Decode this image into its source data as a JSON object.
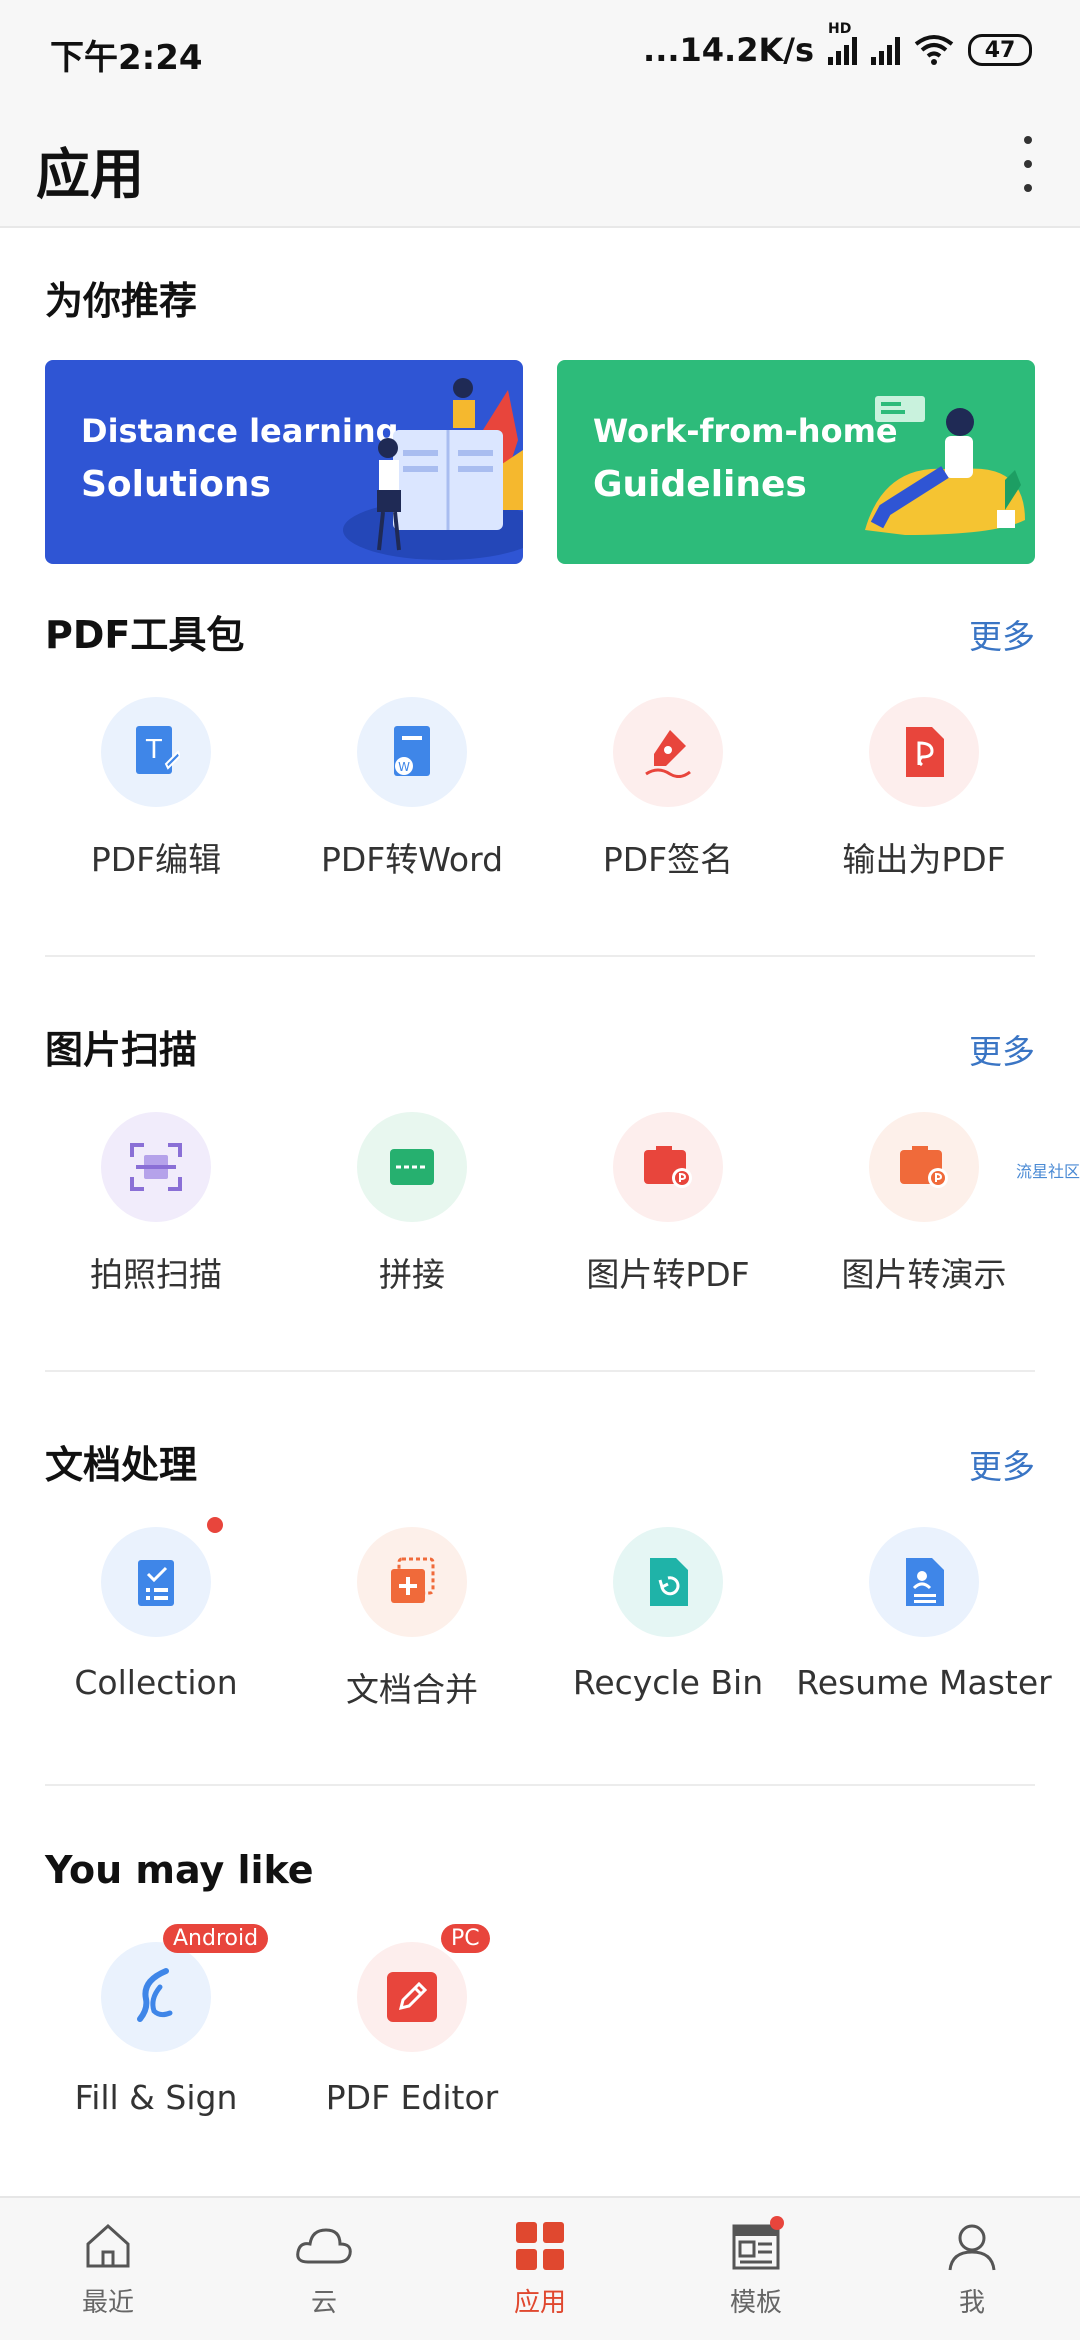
{
  "status_bar": {
    "time": "下午2:24",
    "network_speed": "...14.2K/s",
    "network_badge": "HD",
    "battery": "47"
  },
  "header": {
    "title": "应用"
  },
  "recommend": {
    "title": "为你推荐",
    "banners": [
      {
        "line1": "Distance learning",
        "line2": "Solutions",
        "color": "#2f55d4"
      },
      {
        "line1": "Work-from-home",
        "line2": "Guidelines",
        "color": "#2dbb7a"
      }
    ]
  },
  "pdf_tools": {
    "title": "PDF工具包",
    "more": "更多",
    "items": [
      {
        "label": "PDF编辑",
        "icon": "pdf-edit-icon"
      },
      {
        "label": "PDF转Word",
        "icon": "pdf-to-word-icon"
      },
      {
        "label": "PDF签名",
        "icon": "pdf-sign-icon"
      },
      {
        "label": "输出为PDF",
        "icon": "export-pdf-icon"
      }
    ]
  },
  "image_scan": {
    "title": "图片扫描",
    "more": "更多",
    "items": [
      {
        "label": "拍照扫描",
        "icon": "photo-scan-icon"
      },
      {
        "label": "拼接",
        "icon": "stitch-icon"
      },
      {
        "label": "图片转PDF",
        "icon": "image-to-pdf-icon"
      },
      {
        "label": "图片转演示",
        "icon": "image-to-slides-icon"
      }
    ]
  },
  "doc_process": {
    "title": "文档处理",
    "more": "更多",
    "items": [
      {
        "label": "Collection",
        "icon": "collection-icon"
      },
      {
        "label": "文档合并",
        "icon": "doc-merge-icon"
      },
      {
        "label": "Recycle Bin",
        "icon": "recycle-bin-icon"
      },
      {
        "label": "Resume Master",
        "icon": "resume-icon"
      }
    ]
  },
  "you_may_like": {
    "title": "You may like",
    "items": [
      {
        "label": "Fill & Sign",
        "icon": "fill-sign-icon",
        "tag": "Android"
      },
      {
        "label": "PDF Editor",
        "icon": "pdf-editor-icon",
        "tag": "PC"
      }
    ]
  },
  "watermark": "流星社区",
  "bottom_nav": [
    {
      "label": "最近",
      "icon": "home-icon"
    },
    {
      "label": "云",
      "icon": "cloud-icon"
    },
    {
      "label": "应用",
      "icon": "apps-icon",
      "active": true
    },
    {
      "label": "模板",
      "icon": "template-icon"
    },
    {
      "label": "我",
      "icon": "profile-icon"
    }
  ]
}
